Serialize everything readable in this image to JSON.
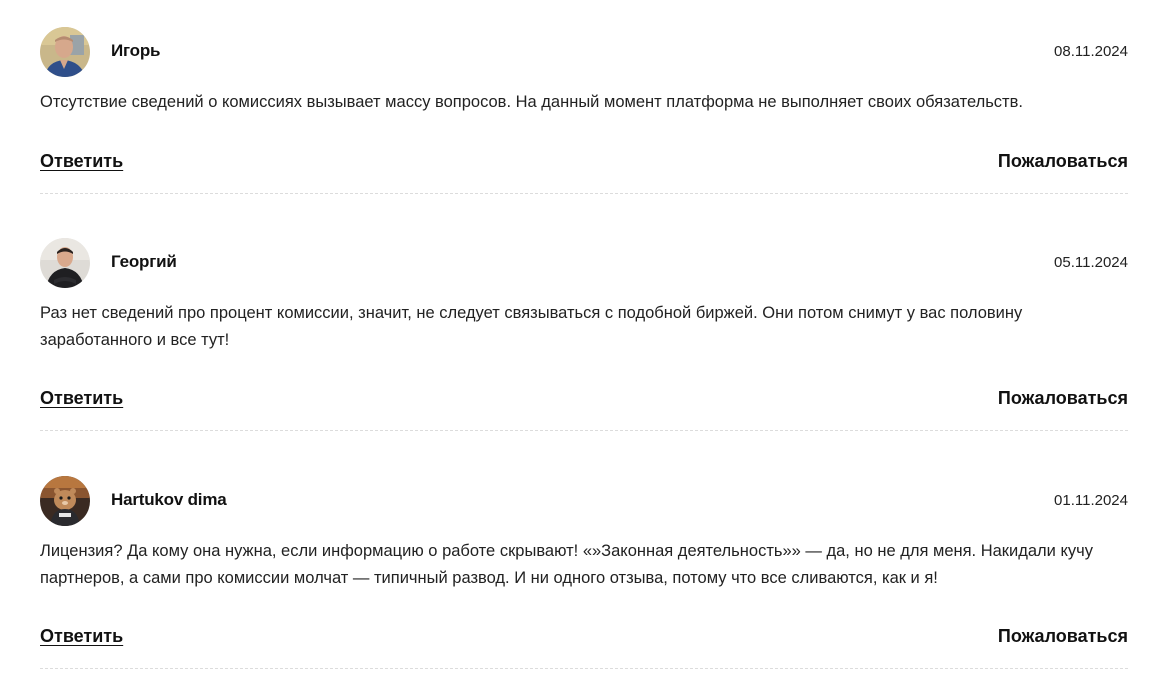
{
  "comments": [
    {
      "author": "Игорь",
      "date": "08.11.2024",
      "text": "Отсутствие сведений о комиссиях вызывает массу вопросов. На данный момент платформа не выполняет своих обязательств.",
      "reply_label": "Ответить",
      "report_label": "Пожаловаться",
      "avatar": "user-photo"
    },
    {
      "author": "Георгий",
      "date": "05.11.2024",
      "text": "Раз нет сведений про процент комиссии, значит, не следует связываться с подобной биржей. Они потом снимут у вас половину заработанного и все тут!",
      "reply_label": "Ответить",
      "report_label": "Пожаловаться",
      "avatar": "user-photo"
    },
    {
      "author": "Hartukov dima",
      "date": "01.11.2024",
      "text": "Лицензия? Да кому она нужна, если информацию о работе скрывают! «»Законная деятельность»» — да, но не для меня. Накидали кучу партнеров, а сами про комиссии молчат — типичный развод. И ни одного отзыва, потому что все сливаются, как и я!",
      "reply_label": "Ответить",
      "report_label": "Пожаловаться",
      "avatar": "hamster-picture"
    }
  ]
}
